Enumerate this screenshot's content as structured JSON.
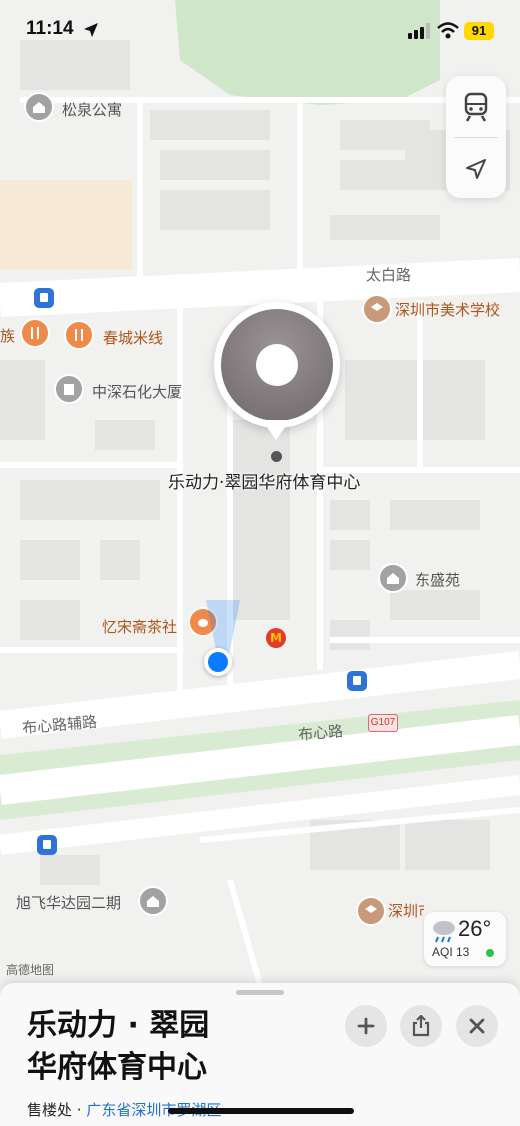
{
  "status_bar": {
    "time": "11:14",
    "battery": "91"
  },
  "map": {
    "labels": {
      "songquan": "松泉公寓",
      "taibai_road": "太白路",
      "art_school": "深圳市美术学校",
      "clan_partial": "族",
      "chuncheng": "春城米线",
      "sinopec": "中深石化大厦",
      "dongsheng": "东盛苑",
      "tea_house": "忆宋斋茶社",
      "buxin_aux": "布心路辅路",
      "buxin_road": "布心路",
      "g107": "G107",
      "xufei": "旭飞华达园二期",
      "school_partial": "深圳市东湖中学"
    },
    "selected_place_label": "乐动力·翠园华府体育中心",
    "provider": "高德地图"
  },
  "weather": {
    "temp": "26°",
    "aqi": "AQI 13"
  },
  "sheet": {
    "title_line1": "乐动力 · 翠园",
    "title_line2": "华府体育中心",
    "category": "售楼处 · ",
    "address": "广东省深圳市罗湖区"
  },
  "colors": {
    "accent": "#0a7aff",
    "park": "#cfe6c8",
    "poi_orange": "#f08a4b",
    "battery": "#ffd800"
  }
}
